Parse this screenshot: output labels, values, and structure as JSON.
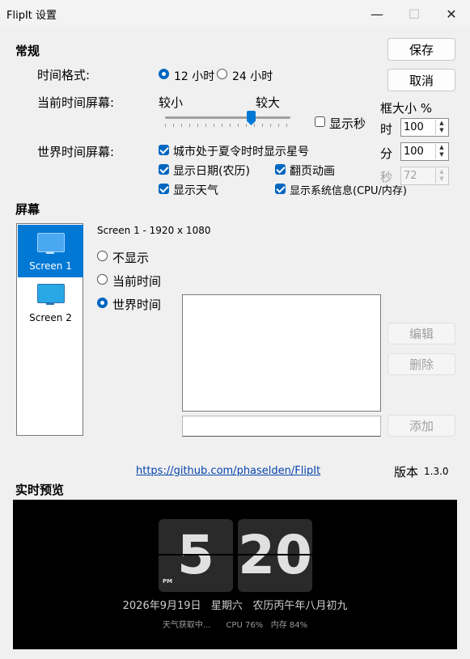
{
  "window": {
    "title": "FlipIt 设置",
    "minimize_icon": "—",
    "maximize_icon": "☐",
    "close_icon": "✕"
  },
  "general": {
    "section_title": "常规",
    "time_format_label": "时间格式:",
    "time_format_options": [
      {
        "label": "12 小时",
        "selected": true
      },
      {
        "label": "24 小时",
        "selected": false
      }
    ],
    "current_time_screen_label": "当前时间屏幕:",
    "size_small_label": "较小",
    "size_large_label": "较大",
    "size_slider_value": 0.73,
    "show_seconds_label": "显示秒",
    "show_seconds_checked": false,
    "world_time_screen_label": "世界时间屏幕:",
    "options": {
      "dst_star": {
        "label": "城市处于夏令时时显示星号",
        "checked": true
      },
      "show_date": {
        "label": "显示日期(农历)",
        "checked": true
      },
      "flip_anim": {
        "label": "翻页动画",
        "checked": true
      },
      "show_weather": {
        "label": "显示天气",
        "checked": true
      },
      "show_sysinfo": {
        "label": "显示系统信息(CPU/内存)",
        "checked": true
      }
    }
  },
  "buttons": {
    "save": "保存",
    "cancel": "取消",
    "edit": "编辑",
    "delete": "删除",
    "add": "添加"
  },
  "box_size": {
    "title": "框大小 %",
    "hour": {
      "label": "时",
      "value": "100"
    },
    "minute": {
      "label": "分",
      "value": "100"
    },
    "second": {
      "label": "秒",
      "value": "72"
    }
  },
  "screens": {
    "section_title": "屏幕",
    "items": [
      {
        "label": "Screen 1",
        "selected": true
      },
      {
        "label": "Screen 2",
        "selected": false
      }
    ],
    "selected_info": "Screen 1 - 1920 x 1080",
    "modes": [
      {
        "label": "不显示",
        "selected": false
      },
      {
        "label": "当前时间",
        "selected": false
      },
      {
        "label": "世界时间",
        "selected": true
      }
    ]
  },
  "footer": {
    "link": "https://github.com/phaselden/FlipIt",
    "version_label": "版本",
    "version_number": "1.3.0"
  },
  "preview": {
    "section_title": "实时预览",
    "hour": "5",
    "minute": "20",
    "ampm": "PM",
    "date_line": "2026年9月19日   星期六   农历丙午年八月初九",
    "info_line": "天气获取中...      CPU 76%   内存 84%"
  },
  "colors": {
    "accent": "#0078d4",
    "check_accent": "#0067c0",
    "preview_bg": "#000000",
    "card_bg": "#2a2a2a"
  }
}
